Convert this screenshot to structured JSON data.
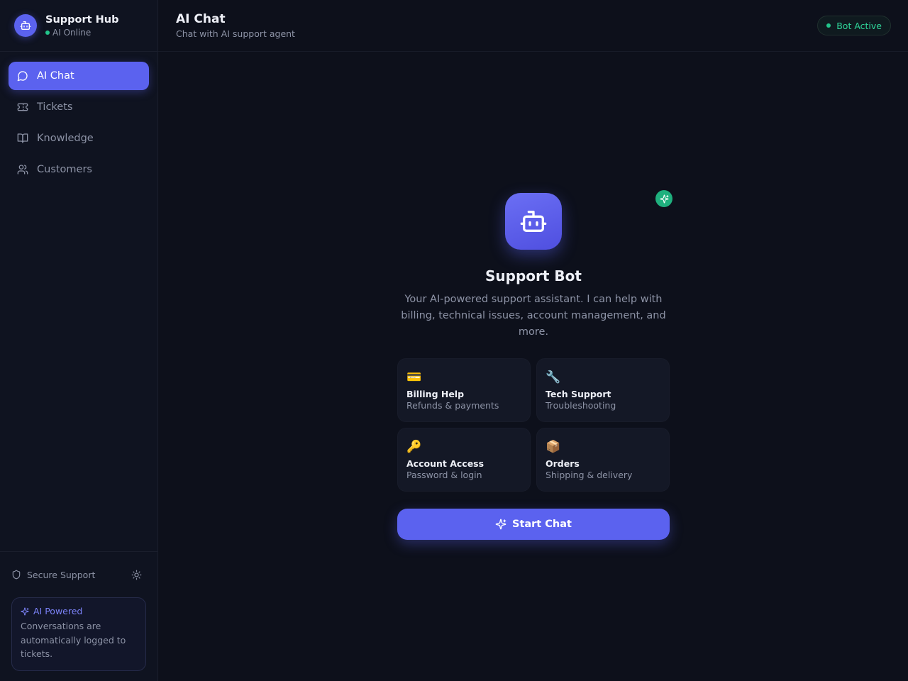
{
  "brand": {
    "name": "Support Hub",
    "status": "AI Online",
    "icon": "robot-icon"
  },
  "nav": {
    "items": [
      {
        "label": "AI Chat",
        "icon": "message-circle-icon",
        "active": true
      },
      {
        "label": "Tickets",
        "icon": "ticket-icon",
        "active": false
      },
      {
        "label": "Knowledge",
        "icon": "book-open-icon",
        "active": false
      },
      {
        "label": "Customers",
        "icon": "users-icon",
        "active": false
      }
    ]
  },
  "footer": {
    "secure_label": "Secure Support",
    "theme_icon": "sun-icon",
    "ai_card": {
      "title": "AI Powered",
      "body": "Conversations are automatically logged to tickets."
    }
  },
  "header": {
    "title": "AI Chat",
    "subtitle": "Chat with AI support agent",
    "status_badge": "Bot Active"
  },
  "welcome": {
    "bot_name": "Support Bot",
    "description": "Your AI-powered support assistant. I can help with billing, technical issues, account management, and more.",
    "topics": [
      {
        "emoji": "💳",
        "title": "Billing Help",
        "subtitle": "Refunds & payments"
      },
      {
        "emoji": "🔧",
        "title": "Tech Support",
        "subtitle": "Troubleshooting"
      },
      {
        "emoji": "🔑",
        "title": "Account Access",
        "subtitle": "Password & login"
      },
      {
        "emoji": "📦",
        "title": "Orders",
        "subtitle": "Shipping & delivery"
      }
    ],
    "start_button": "Start Chat"
  },
  "colors": {
    "accent": "#5b62ef",
    "success": "#22c58b",
    "background": "#0d101b",
    "sidebar": "#0f1320"
  }
}
